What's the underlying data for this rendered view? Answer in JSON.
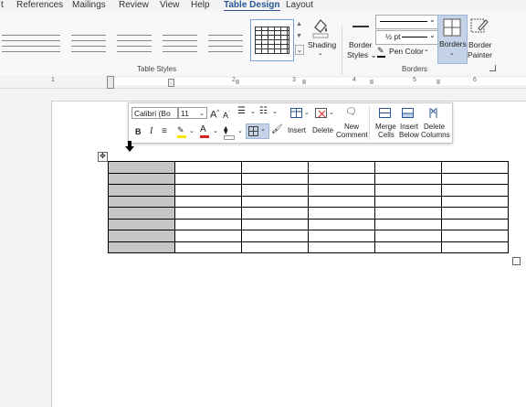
{
  "menu": {
    "tabs": [
      {
        "label": "t"
      },
      {
        "label": "References"
      },
      {
        "label": "Mailings"
      },
      {
        "label": "Review"
      },
      {
        "label": "View"
      },
      {
        "label": "Help"
      },
      {
        "label": "Table Design",
        "active": true
      },
      {
        "label": "Layout"
      }
    ]
  },
  "ribbon": {
    "table_styles_label": "Table Styles",
    "borders_label": "Borders",
    "shading": "Shading",
    "border_styles_line1": "Border",
    "border_styles_line2": "Styles",
    "pen_weight": "½ pt",
    "pen_color": "Pen Color",
    "borders": "Borders",
    "border_painter_line1": "Border",
    "border_painter_line2": "Painter"
  },
  "ruler": {
    "numbers": [
      "1",
      "2",
      "3",
      "4",
      "5",
      "6"
    ]
  },
  "mini_toolbar": {
    "font_name": "Calibri (Bo",
    "font_size": "11",
    "insert": "Insert",
    "delete": "Delete",
    "new_comment_line1": "New",
    "new_comment_line2": "Comment",
    "merge_cells_line1": "Merge",
    "merge_cells_line2": "Cells",
    "insert_below_line1": "Insert",
    "insert_below_line2": "Below",
    "delete_columns_line1": "Delete",
    "delete_columns_line2": "Columns"
  },
  "table": {
    "rows": 8,
    "cols": 6,
    "selected_column": 0
  },
  "colors": {
    "accent": "#2b579a",
    "selected_cells": "#c6c6c6",
    "borders_button_active": "#c5d3e8",
    "highlight_yellow": "#f5e600",
    "font_red": "#e02020"
  }
}
